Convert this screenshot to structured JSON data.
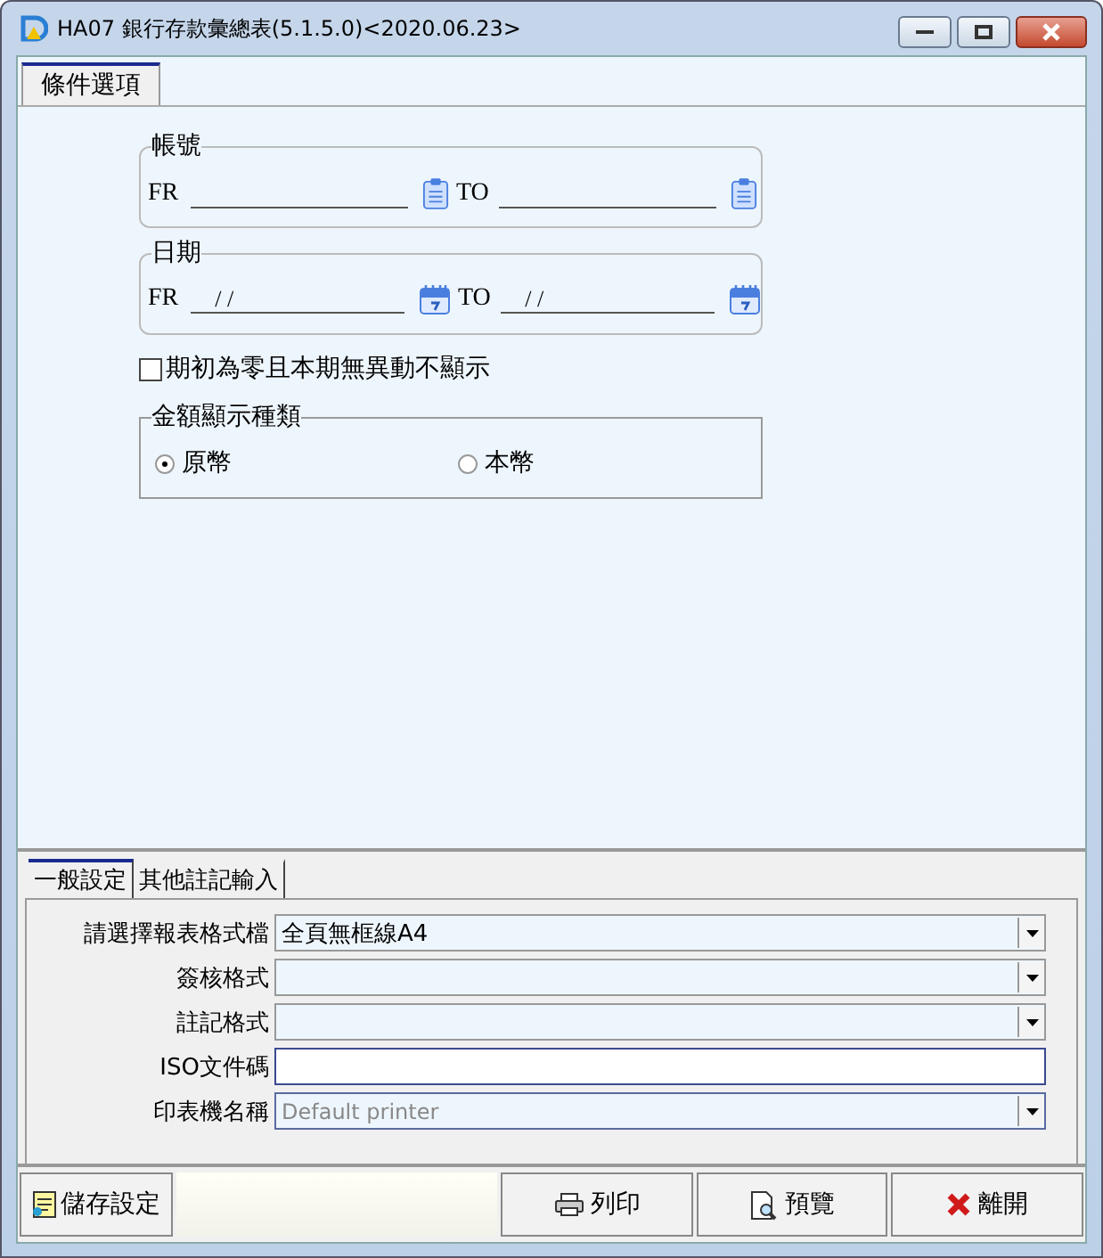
{
  "window": {
    "title": "HA07 銀行存款彙總表(5.1.5.0)<2020.06.23>"
  },
  "tabs": [
    {
      "label": "條件選項",
      "selected": true
    }
  ],
  "range_groups": [
    {
      "kind": "picker",
      "legend": "帳號",
      "from_label": "FR",
      "to_label": "TO"
    },
    {
      "kind": "date",
      "legend": "日期",
      "from_label": "FR",
      "from_value": "/ /",
      "to_label": "TO",
      "to_value": "/ /"
    }
  ],
  "checkbox": {
    "label": "期初為零且本期無異動不顯示",
    "checked": false
  },
  "currency_group": {
    "legend": "金額顯示種類",
    "options": [
      {
        "label": "原幣",
        "selected": true
      },
      {
        "label": "本幣",
        "selected": false
      }
    ]
  },
  "settings_tabs": [
    {
      "label": "一般設定",
      "selected": true
    },
    {
      "label": "其他註記輸入",
      "selected": false
    }
  ],
  "settings_fields": [
    {
      "kind": "combo",
      "label": "請選擇報表格式檔",
      "value": "全頁無框線A4",
      "disabled": false
    },
    {
      "kind": "combo",
      "label": "簽核格式",
      "disabled": false
    },
    {
      "kind": "combo",
      "label": "註記格式",
      "disabled": false
    },
    {
      "kind": "text",
      "label": "ISO文件碼",
      "disabled": false
    },
    {
      "kind": "combo",
      "label": "印表機名稱",
      "value": "Default printer",
      "disabled": true
    }
  ],
  "buttons": [
    {
      "kind": "save",
      "label": "儲存設定"
    },
    {
      "kind": "print",
      "label": "列印"
    },
    {
      "kind": "preview",
      "label": "預覽"
    },
    {
      "kind": "close",
      "label": "離開"
    }
  ]
}
